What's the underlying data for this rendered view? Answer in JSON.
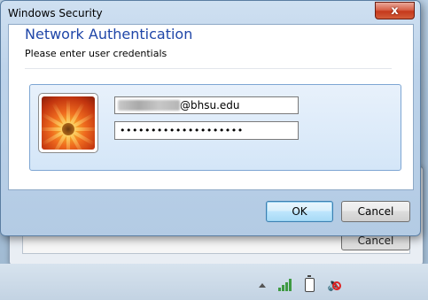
{
  "window": {
    "title": "Windows Security",
    "close_glyph": "x"
  },
  "content": {
    "heading": "Network Authentication",
    "subheading": "Please enter user credentials"
  },
  "credentials": {
    "username_visible_suffix": "@bhsu.edu",
    "password_masked": "••••••••••••••••••••"
  },
  "buttons": {
    "ok_label": "OK",
    "cancel_label": "Cancel"
  },
  "background_window": {
    "button_label": "Cancel"
  },
  "tray": {
    "icons": [
      "show-hidden-icons-icon",
      "network-icon",
      "battery-icon",
      "volume-muted-icon"
    ]
  },
  "colors": {
    "heading": "#1f46a8",
    "close_button": "#c5391c"
  }
}
